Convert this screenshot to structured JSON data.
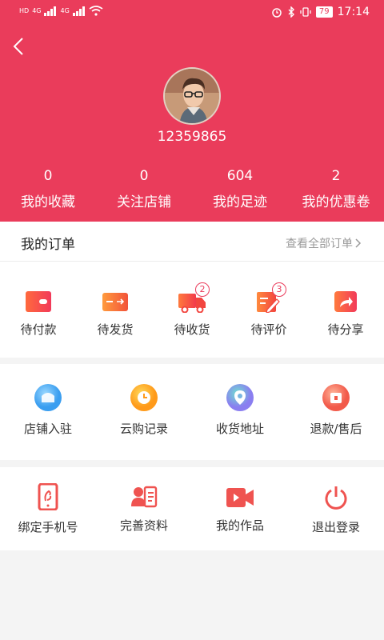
{
  "statusbar": {
    "left_glyphs": [
      "HD",
      "4G",
      "4G"
    ],
    "battery": "79",
    "time": "17:14"
  },
  "profile": {
    "username": "12359865",
    "stats": [
      {
        "value": "0",
        "label": "我的收藏"
      },
      {
        "value": "0",
        "label": "关注店铺"
      },
      {
        "value": "604",
        "label": "我的足迹"
      },
      {
        "value": "2",
        "label": "我的优惠卷"
      }
    ]
  },
  "orders": {
    "title": "我的订单",
    "view_all": "查看全部订单",
    "items": [
      {
        "label": "待付款",
        "icon": "wallet-icon"
      },
      {
        "label": "待发货",
        "icon": "card-ship-icon"
      },
      {
        "label": "待收货",
        "icon": "truck-icon",
        "badge": "2"
      },
      {
        "label": "待评价",
        "icon": "review-edit-icon",
        "badge": "3"
      },
      {
        "label": "待分享",
        "icon": "share-icon"
      }
    ]
  },
  "services": [
    {
      "label": "店铺入驻",
      "icon": "store-icon"
    },
    {
      "label": "云购记录",
      "icon": "clock-icon"
    },
    {
      "label": "收货地址",
      "icon": "location-icon"
    },
    {
      "label": "退款/售后",
      "icon": "refund-icon"
    }
  ],
  "account": [
    {
      "label": "绑定手机号",
      "icon": "phone-icon"
    },
    {
      "label": "完善资料",
      "icon": "profile-card-icon"
    },
    {
      "label": "我的作品",
      "icon": "video-icon"
    },
    {
      "label": "退出登录",
      "icon": "power-icon"
    }
  ],
  "colors": {
    "brand": "#ea3c5b",
    "icon_red": "#ef5350",
    "icon_orange": "#ff8a3d"
  }
}
